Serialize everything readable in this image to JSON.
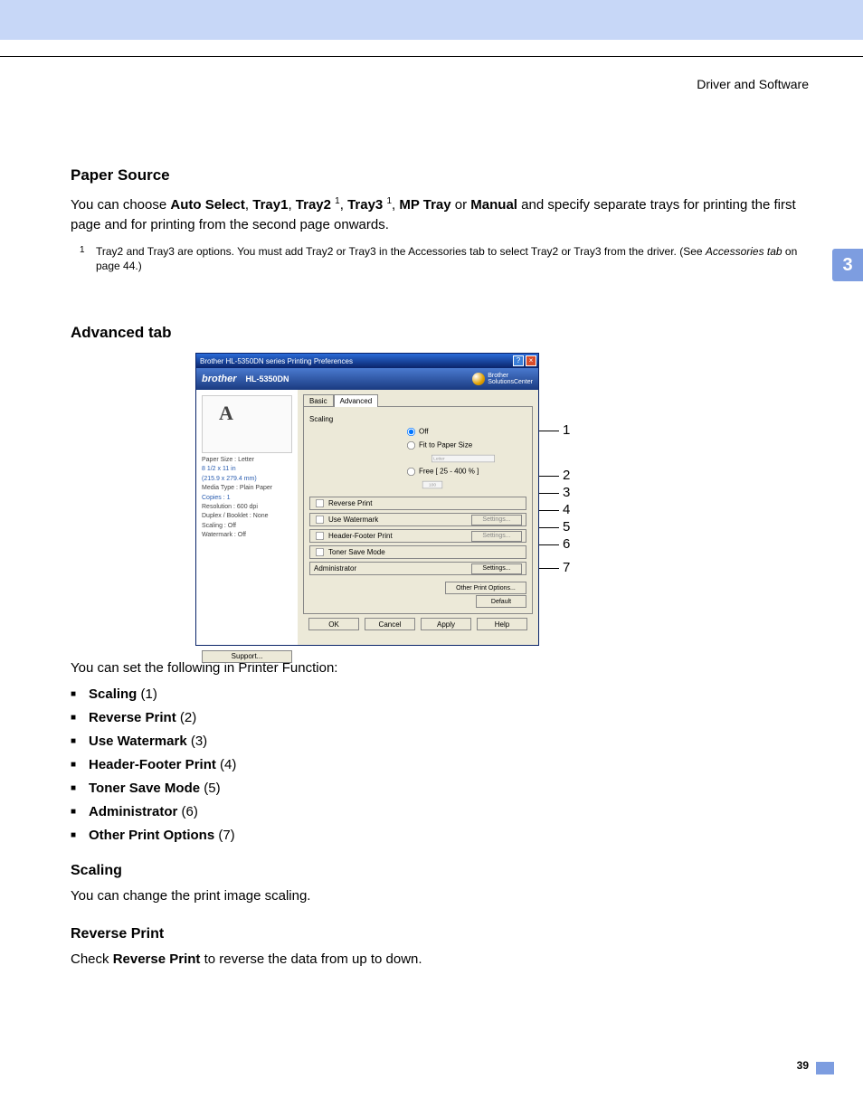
{
  "header": {
    "section": "Driver and Software",
    "chapter": "3",
    "page": "39"
  },
  "paper_source": {
    "heading": "Paper Source",
    "p1_a": "You can choose ",
    "opt1": "Auto Select",
    "c1": ", ",
    "opt2": "Tray1",
    "c2": ", ",
    "opt3": "Tray2",
    "sup1": "1",
    "c3": ", ",
    "opt4": "Tray3",
    "sup2": "1",
    "c4": ", ",
    "opt5": "MP Tray",
    "c5": " or ",
    "opt6": "Manual",
    "p1_b": " and specify separate trays for printing the first page and for printing from the second page onwards.",
    "fn_num": "1",
    "fn_a": "Tray2 and Tray3 are options. You must add Tray2 or Tray3 in the Accessories tab to select Tray2 or Tray3 from the driver. (See ",
    "fn_i": "Accessories tab",
    "fn_b": " on page 44.)"
  },
  "advanced": {
    "heading": "Advanced tab",
    "intro": "You can set the following in Printer Function:",
    "items": [
      {
        "name": "Scaling",
        "num": "(1)"
      },
      {
        "name": "Reverse Print",
        "num": "(2)"
      },
      {
        "name": "Use Watermark",
        "num": "(3)"
      },
      {
        "name": "Header-Footer Print",
        "num": "(4)"
      },
      {
        "name": "Toner Save Mode",
        "num": "(5)"
      },
      {
        "name": "Administrator",
        "num": "(6)"
      },
      {
        "name": "Other Print Options",
        "num": "(7)"
      }
    ]
  },
  "scaling": {
    "heading": "Scaling",
    "text": "You can change the print image scaling."
  },
  "reverse": {
    "heading": "Reverse Print",
    "a": "Check ",
    "b": "Reverse Print",
    "c": " to reverse the data from up to down."
  },
  "dialog": {
    "title": "Brother HL-5350DN series Printing Preferences",
    "brand": "brother",
    "model": "HL-5350DN",
    "sc_a": "Brother",
    "sc_b": "SolutionsCenter",
    "info": {
      "l1": "Paper Size : Letter",
      "l2": "8 1/2 x 11 in",
      "l3": "(215.9 x 279.4 mm)",
      "l4": "Media Type : Plain Paper",
      "l5": "Copies : 1",
      "l6": "Resolution : 600 dpi",
      "l7": "Duplex / Booklet : None",
      "l8": "Scaling : Off",
      "l9": "Watermark : Off"
    },
    "support": "Support...",
    "tabs": {
      "basic": "Basic",
      "advanced": "Advanced"
    },
    "scaling_lbl": "Scaling",
    "r_off": "Off",
    "r_fit": "Fit to Paper Size",
    "sel_letter": "Letter",
    "r_free": "Free [ 25 - 400 % ]",
    "free_val": "100",
    "chk_rev": "Reverse Print",
    "chk_wm": "Use Watermark",
    "chk_hf": "Header-Footer Print",
    "chk_ts": "Toner Save Mode",
    "adm": "Administrator",
    "settings": "Settings...",
    "opo": "Other Print Options...",
    "def": "Default",
    "ok": "OK",
    "cancel": "Cancel",
    "apply": "Apply",
    "help": "Help"
  },
  "callouts": {
    "n1": "1",
    "n2": "2",
    "n3": "3",
    "n4": "4",
    "n5": "5",
    "n6": "6",
    "n7": "7"
  }
}
